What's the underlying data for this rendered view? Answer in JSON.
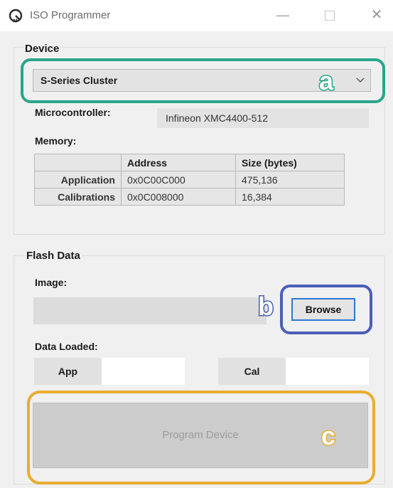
{
  "window": {
    "title": "ISO Programmer",
    "icon": "iso-app-icon",
    "controls": {
      "minimize": "—",
      "close": "✕"
    }
  },
  "device": {
    "group_title": "Device",
    "selected": "S-Series Cluster",
    "microcontroller_label": "Microcontroller:",
    "microcontroller_value": "Infineon XMC4400-512",
    "memory_label": "Memory:",
    "memory_table": {
      "columns": [
        "Address",
        "Size (bytes)"
      ],
      "rows": [
        {
          "name": "Application",
          "address": "0x0C00C000",
          "size": "475,136"
        },
        {
          "name": "Calibrations",
          "address": "0x0C008000",
          "size": "16,384"
        }
      ]
    }
  },
  "flash": {
    "group_title": "Flash Data",
    "image_label": "Image:",
    "image_value": "",
    "browse_label": "Browse",
    "data_loaded_label": "Data Loaded:",
    "app_label": "App",
    "app_value": "",
    "cal_label": "Cal",
    "cal_value": "",
    "program_label": "Program Device"
  },
  "annotations": {
    "a": "a",
    "b": "b",
    "c": "c"
  },
  "colors": {
    "annotation_a": "#27a688",
    "annotation_b": "#4a5fb6",
    "annotation_c": "#e9ad2f",
    "browse_border": "#2f78cf"
  }
}
